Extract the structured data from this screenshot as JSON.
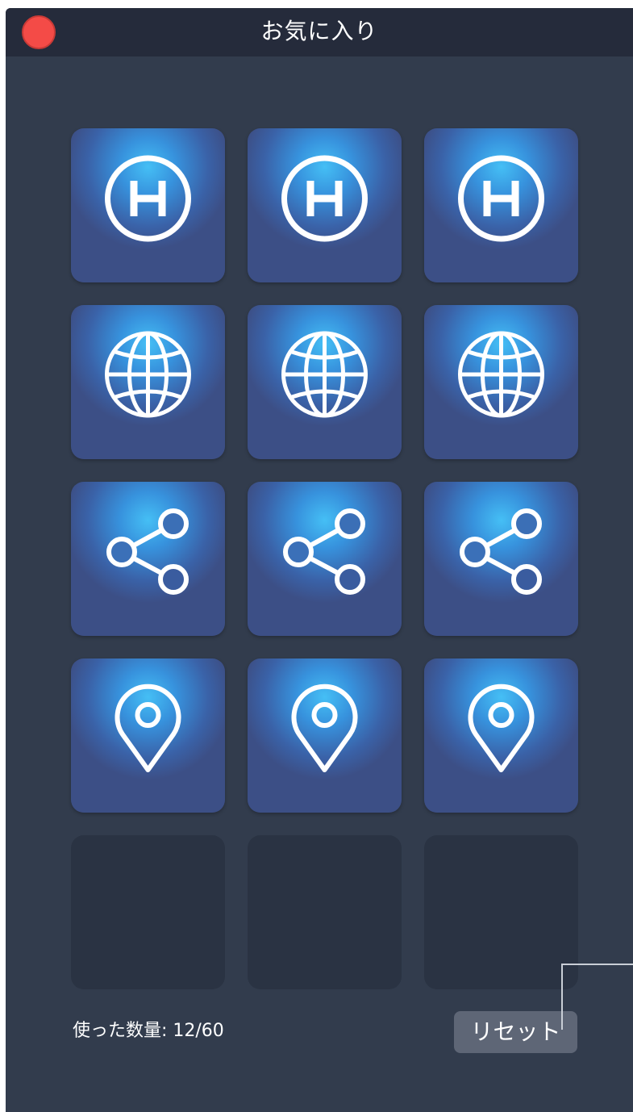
{
  "window": {
    "title": "お気に入り"
  },
  "grid": {
    "rows": [
      [
        "hospital-icon",
        "hospital-icon",
        "hospital-icon"
      ],
      [
        "globe-icon",
        "globe-icon",
        "globe-icon"
      ],
      [
        "share-icon",
        "share-icon",
        "share-icon"
      ],
      [
        "location-pin-icon",
        "location-pin-icon",
        "location-pin-icon"
      ],
      [
        "",
        "",
        ""
      ]
    ]
  },
  "footer": {
    "usage_text": "使った数量: 12/60",
    "reset_label": "リセット"
  },
  "colors": {
    "window_bg": "#323c4d",
    "titlebar_bg": "#252b3b",
    "close_button": "#f44b47",
    "tile_glow": "#45bff5",
    "tile_base": "#3c4f86",
    "empty_tile": "#2a3343",
    "reset_button": "#5e6676"
  }
}
